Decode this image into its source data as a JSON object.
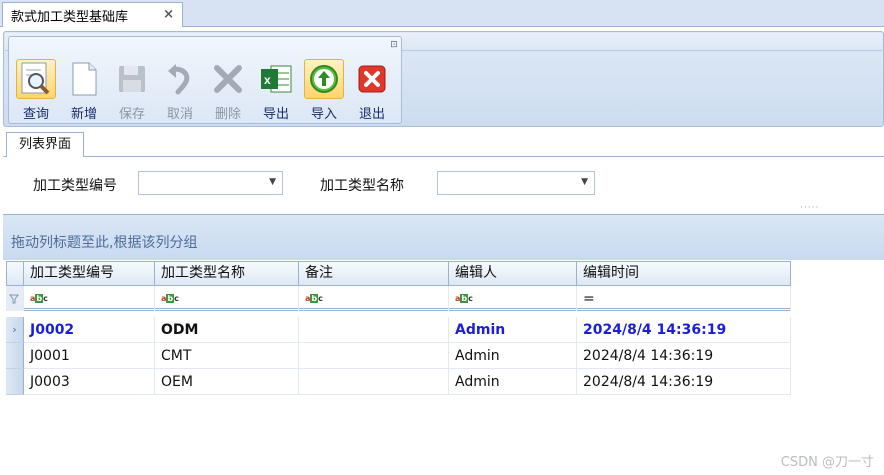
{
  "document_tab": {
    "title": "款式加工类型基础库",
    "close": "×"
  },
  "ribbon": {
    "launcher": "⊡",
    "buttons": [
      {
        "label": "查询",
        "icon": "search-document-icon",
        "enabled": true
      },
      {
        "label": "新增",
        "icon": "new-document-icon",
        "enabled": true
      },
      {
        "label": "保存",
        "icon": "floppy-disk-icon",
        "enabled": false
      },
      {
        "label": "取消",
        "icon": "undo-arrow-icon",
        "enabled": false
      },
      {
        "label": "删除",
        "icon": "delete-x-icon",
        "enabled": false
      },
      {
        "label": "导出",
        "icon": "excel-export-icon",
        "enabled": true
      },
      {
        "label": "导入",
        "icon": "import-arrow-icon",
        "enabled": true
      },
      {
        "label": "退出",
        "icon": "exit-red-x-icon",
        "enabled": true
      }
    ]
  },
  "list_tab": {
    "label": "列表界面"
  },
  "filters": {
    "code_label": "加工类型编号",
    "name_label": "加工类型名称",
    "code_value": "",
    "name_value": ""
  },
  "grid": {
    "group_panel_text": "拖动列标题至此,根据该列分组",
    "columns": [
      "加工类型编号",
      "加工类型名称",
      "备注",
      "编辑人",
      "编辑时间"
    ],
    "filter_row": {
      "text_filter_icon": "abc-text-filter-icon",
      "equals_symbol": "="
    },
    "rows": [
      {
        "code": "J0002",
        "name": "ODM",
        "remark": "",
        "editor": "Admin",
        "edit_time": "2024/8/4 14:36:19",
        "focused": true
      },
      {
        "code": "J0001",
        "name": "CMT",
        "remark": "",
        "editor": "Admin",
        "edit_time": "2024/8/4 14:36:19",
        "focused": false
      },
      {
        "code": "J0003",
        "name": "OEM",
        "remark": "",
        "editor": "Admin",
        "edit_time": "2024/8/4 14:36:19",
        "focused": false
      }
    ],
    "row_indicator": "›"
  },
  "watermark": "CSDN @刀一寸",
  "colors": {
    "focused_text": "#1a1fd6",
    "accent_blue": "#4f6b99",
    "header_border": "#9bb3d3"
  }
}
